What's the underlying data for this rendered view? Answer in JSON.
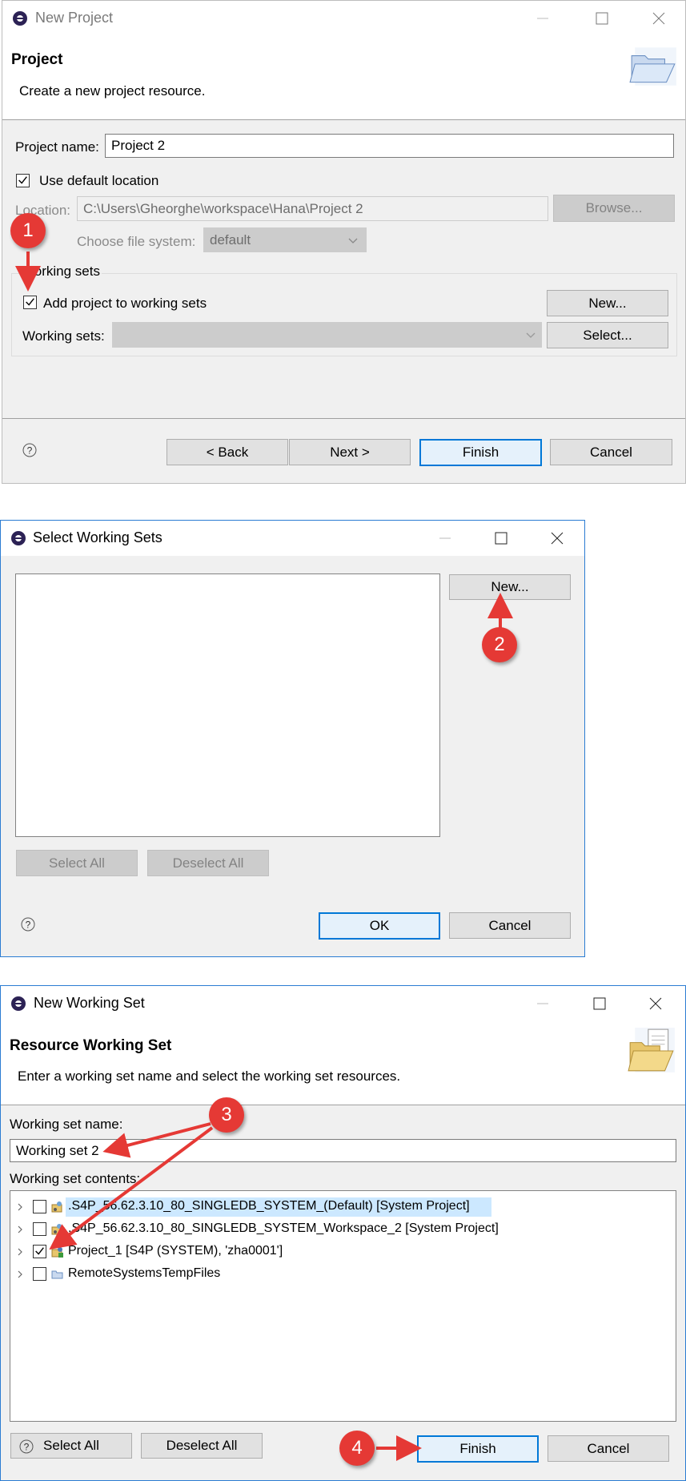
{
  "dialog1": {
    "window_title": "New Project",
    "header_title": "Project",
    "header_desc": "Create a new project resource.",
    "project_name_label": "Project name:",
    "project_name_value": "Project 2",
    "use_default_location_label": "Use default location",
    "use_default_location_checked": true,
    "location_label": "Location:",
    "location_value": "C:\\Users\\Gheorghe\\workspace\\Hana\\Project 2",
    "browse_button": "Browse...",
    "choose_fs_label": "Choose file system:",
    "choose_fs_value": "default",
    "working_sets_group": "Working sets",
    "add_to_working_sets_label": "Add project to working sets",
    "add_to_working_sets_checked": true,
    "new_button": "New...",
    "working_sets_label": "Working sets:",
    "working_sets_value": "",
    "select_button": "Select...",
    "back_button": "< Back",
    "next_button": "Next >",
    "finish_button": "Finish",
    "cancel_button": "Cancel"
  },
  "dialog2": {
    "window_title": "Select Working Sets",
    "new_button": "New...",
    "select_all_button": "Select All",
    "deselect_all_button": "Deselect All",
    "ok_button": "OK",
    "cancel_button": "Cancel"
  },
  "dialog3": {
    "window_title": "New Working Set",
    "header_title": "Resource Working Set",
    "header_desc": "Enter a working set name and select the working set resources.",
    "name_label": "Working set name:",
    "name_value": "Working set 2",
    "contents_label": "Working set contents:",
    "tree_items": [
      {
        "label": ".S4P_56.62.3.10_80_SINGLEDB_SYSTEM_(Default) [System Project]",
        "checked": false,
        "icon": "system-project-icon",
        "highlighted": true
      },
      {
        "label": ".S4P_56.62.3.10_80_SINGLEDB_SYSTEM_Workspace_2 [System Project]",
        "checked": false,
        "icon": "system-project-icon",
        "highlighted": false
      },
      {
        "label": "Project_1 [S4P (SYSTEM), 'zha0001']",
        "checked": true,
        "icon": "project-icon",
        "highlighted": false
      },
      {
        "label": "RemoteSystemsTempFiles",
        "checked": false,
        "icon": "folder-icon",
        "highlighted": false
      }
    ],
    "select_all_button": "Select All",
    "deselect_all_button": "Deselect All",
    "finish_button": "Finish",
    "cancel_button": "Cancel"
  },
  "callouts": [
    "1",
    "2",
    "3",
    "4"
  ],
  "colors": {
    "callout": "#e53935",
    "accent": "#0078d7",
    "highlight": "#cce8ff"
  }
}
